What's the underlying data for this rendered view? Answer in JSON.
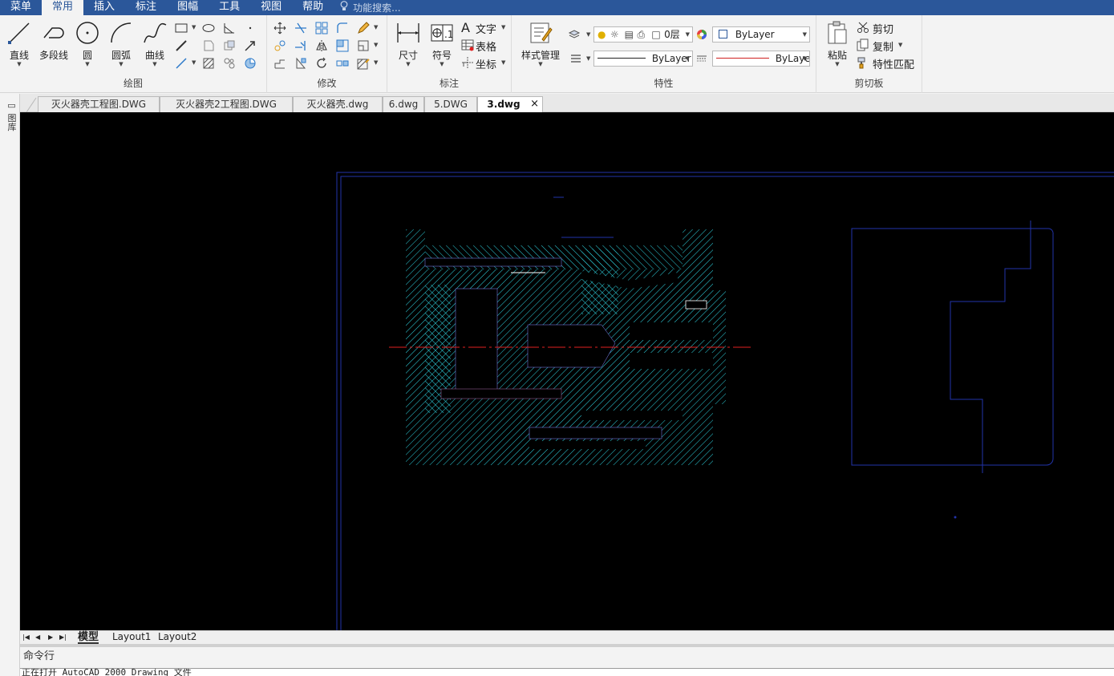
{
  "menubar": {
    "items": [
      "菜单",
      "常用",
      "插入",
      "标注",
      "图幅",
      "工具",
      "视图",
      "帮助"
    ],
    "active_index": 1,
    "search_placeholder": "功能搜索..."
  },
  "ribbon": {
    "groups": {
      "draw": {
        "title": "绘图",
        "line": "直线",
        "polyline": "多段线",
        "circle": "圆",
        "arc": "圆弧",
        "curve": "曲线"
      },
      "modify": {
        "title": "修改"
      },
      "annotate": {
        "title": "标注",
        "dimension": "尺寸",
        "symbol": "符号",
        "text": "文字",
        "table": "表格",
        "coordinate": "坐标"
      },
      "properties": {
        "title": "特性",
        "style_manager": "样式管理",
        "layer_value": "0层",
        "color_value": "ByLayer",
        "linetype_value": "ByLayer",
        "lineweight_value": "ByLaye"
      },
      "clipboard": {
        "title": "剪切板",
        "paste": "粘贴",
        "cut": "剪切",
        "copy": "复制",
        "match_props": "特性匹配"
      }
    }
  },
  "sidepanel": {
    "label": "图库"
  },
  "doc_tabs": [
    "灭火器壳工程图.DWG",
    "灭火器壳2工程图.DWG",
    "灭火器壳.dwg",
    "6.dwg",
    "5.DWG",
    "3.dwg"
  ],
  "doc_tabs_active": 5,
  "layout_tabs": [
    "模型",
    "Layout1",
    "Layout2"
  ],
  "command": {
    "label": "命令行",
    "output": "正在打开 AutoCAD 2000 Drawing 文件"
  },
  "colors": {
    "menubar": "#2b579a",
    "canvas": "#000000",
    "hatch": "#2fd3e0",
    "frame": "#2233aa",
    "centerline": "#e02020"
  }
}
